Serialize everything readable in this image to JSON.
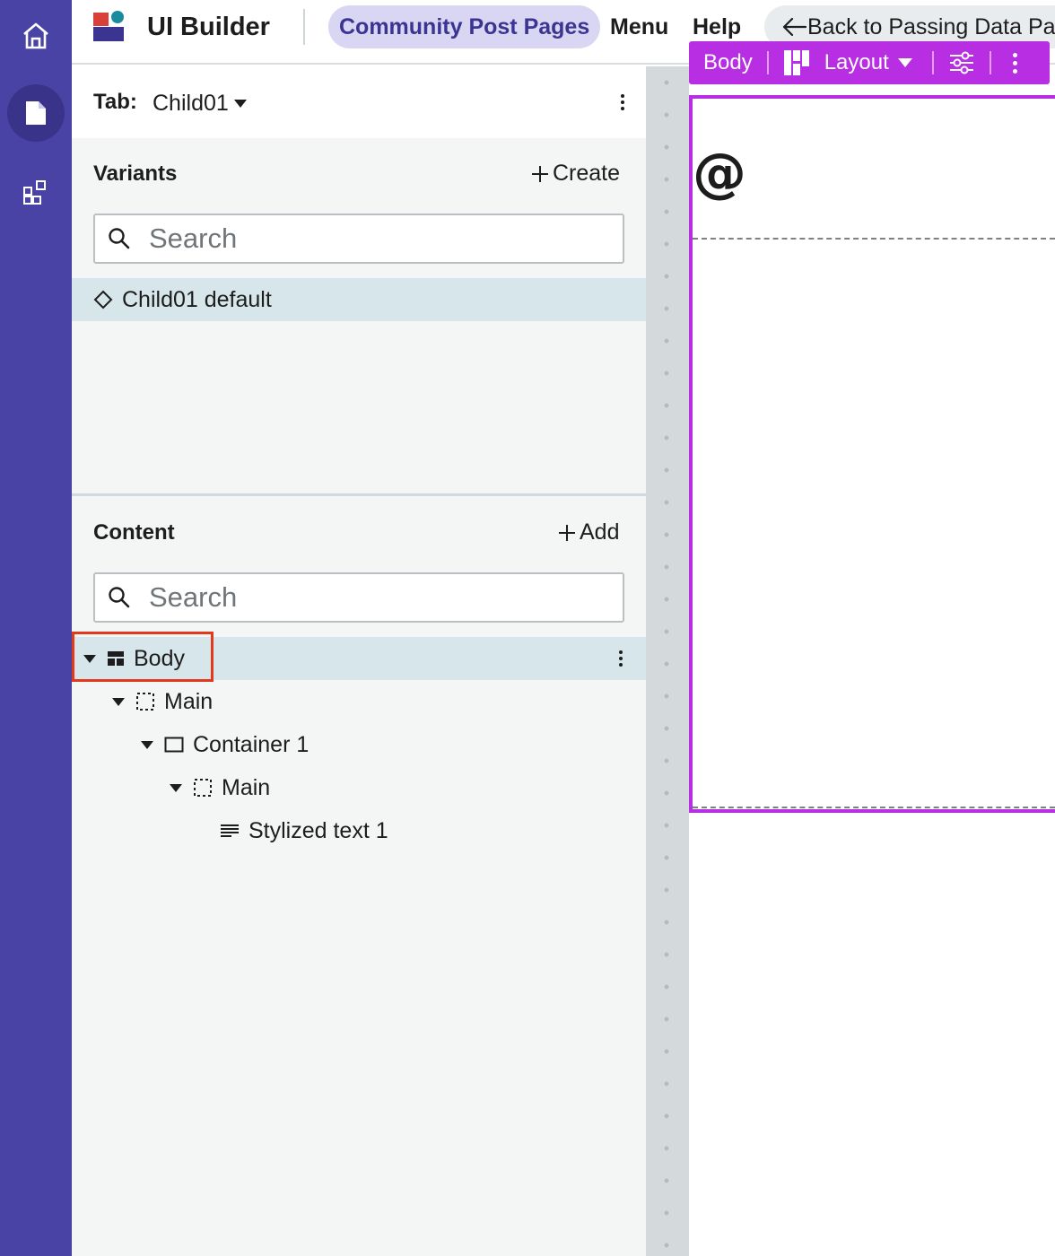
{
  "colors": {
    "rail": "#4a43a6",
    "accent": "#b82ee3",
    "pill_bg": "#d8d6f3",
    "selected_row": "#d6e6ea",
    "highlight": "#e2391c"
  },
  "rail": {
    "items": [
      {
        "icon": "home-icon"
      },
      {
        "icon": "page-icon",
        "active": true
      },
      {
        "icon": "components-icon"
      }
    ]
  },
  "header": {
    "app_title": "UI Builder",
    "page_name": "Community Post Pages",
    "menu_label": "Menu",
    "help_label": "Help",
    "back_label": "Back to Passing Data Pag"
  },
  "tab": {
    "label": "Tab:",
    "value": "Child01"
  },
  "variants": {
    "title": "Variants",
    "create_label": "Create",
    "search_placeholder": "Search",
    "items": [
      {
        "label": "Child01 default",
        "selected": true
      }
    ]
  },
  "content": {
    "title": "Content",
    "add_label": "Add",
    "search_placeholder": "Search",
    "tree": [
      {
        "label": "Body",
        "level": 0,
        "icon": "layout-icon",
        "selected": true
      },
      {
        "label": "Main",
        "level": 1,
        "icon": "slot-icon"
      },
      {
        "label": "Container 1",
        "level": 2,
        "icon": "container-icon"
      },
      {
        "label": "Main",
        "level": 3,
        "icon": "slot-icon"
      },
      {
        "label": "Stylized text 1",
        "level": 4,
        "icon": "text-icon"
      }
    ]
  },
  "canvas": {
    "toolbar": {
      "element_label": "Body",
      "layout_label": "Layout"
    },
    "content_text": "@"
  }
}
